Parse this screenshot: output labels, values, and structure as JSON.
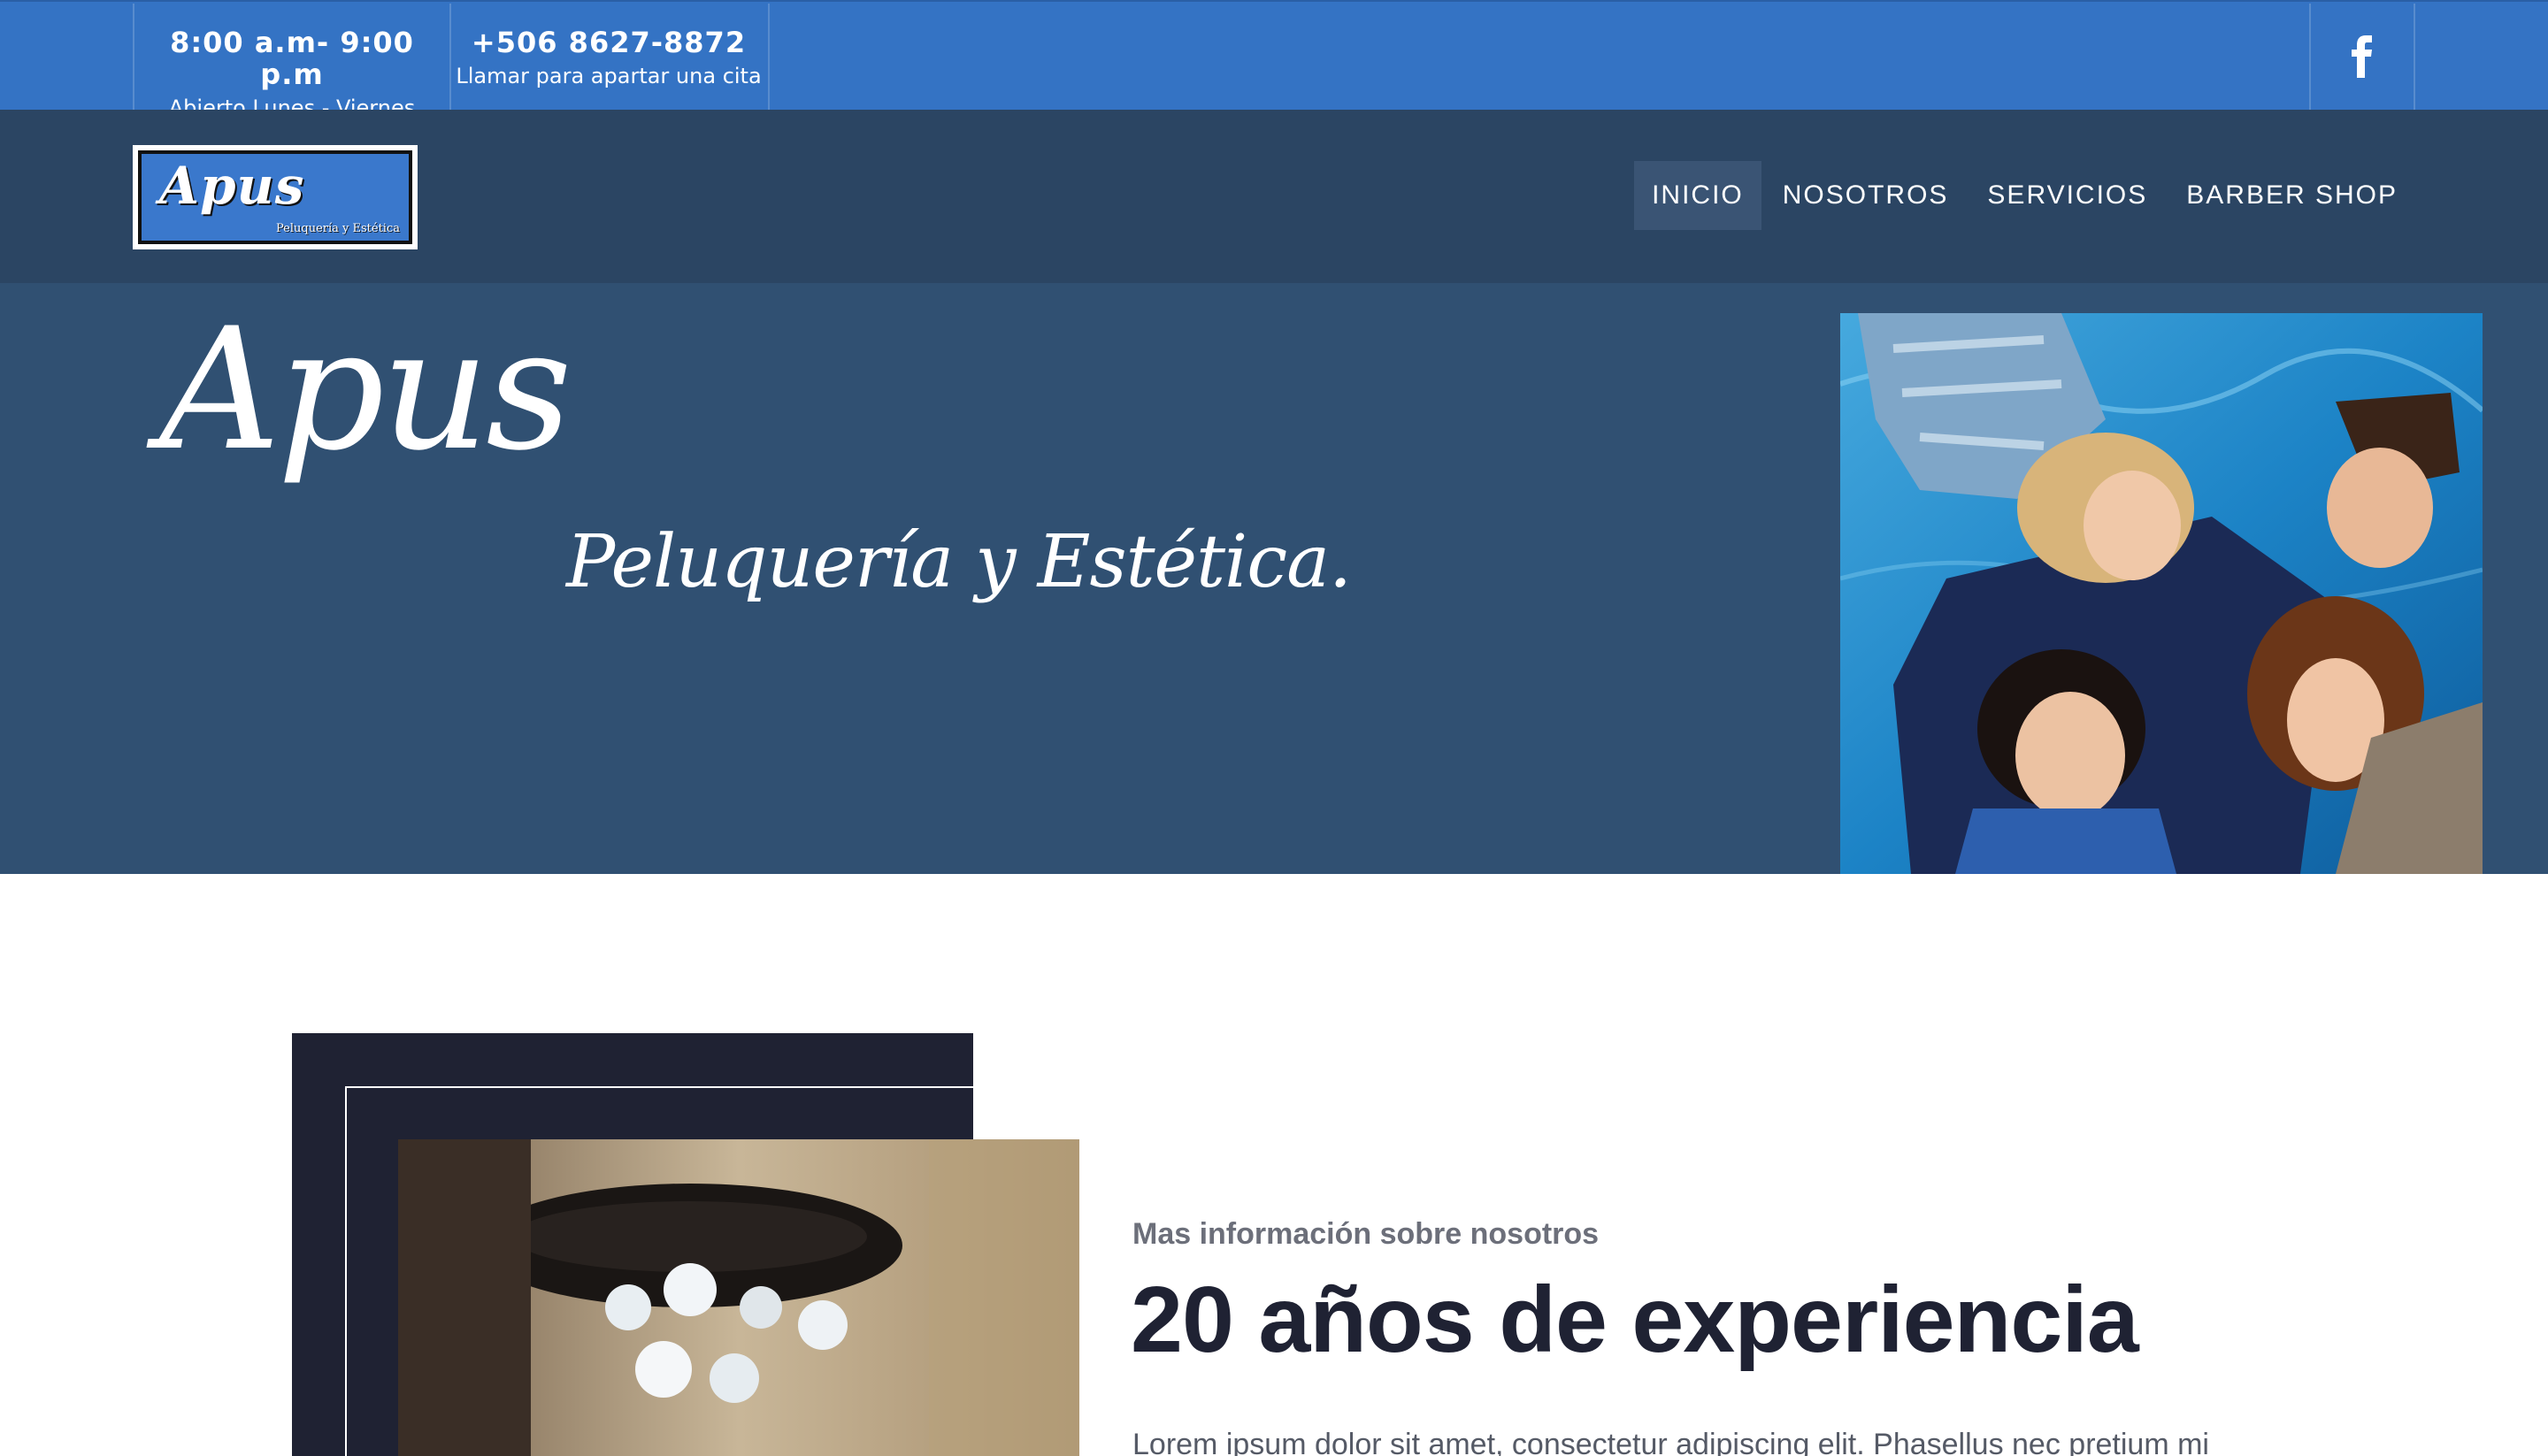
{
  "topbar": {
    "hours": {
      "main": "8:00 a.m- 9:00 p.m",
      "sub": "Abierto Lunes - Viernes"
    },
    "phone": {
      "main": "+506 8627-8872",
      "sub": "Llamar para apartar una cita"
    },
    "social_icon": "facebook-icon"
  },
  "brand": {
    "logo_text": "Apus",
    "logo_sub": "Peluquería y Estética"
  },
  "nav": {
    "items": [
      {
        "label": "INICIO",
        "active": true
      },
      {
        "label": "NOSOTROS",
        "active": false
      },
      {
        "label": "SERVICIOS",
        "active": false
      },
      {
        "label": "BARBER SHOP",
        "active": false
      }
    ]
  },
  "hero": {
    "title": "Apus",
    "subtitle": "Peluquería y Estética."
  },
  "about": {
    "kicker": "Mas información sobre nosotros",
    "title": "20 años de experiencia",
    "body": "Lorem ipsum dolor sit amet, consectetur adipiscing elit. Phasellus nec pretium mi"
  },
  "colors": {
    "topbar": "#3473c4",
    "navbar": "#2b4563",
    "hero": "#305072",
    "dark": "#1f2233"
  }
}
